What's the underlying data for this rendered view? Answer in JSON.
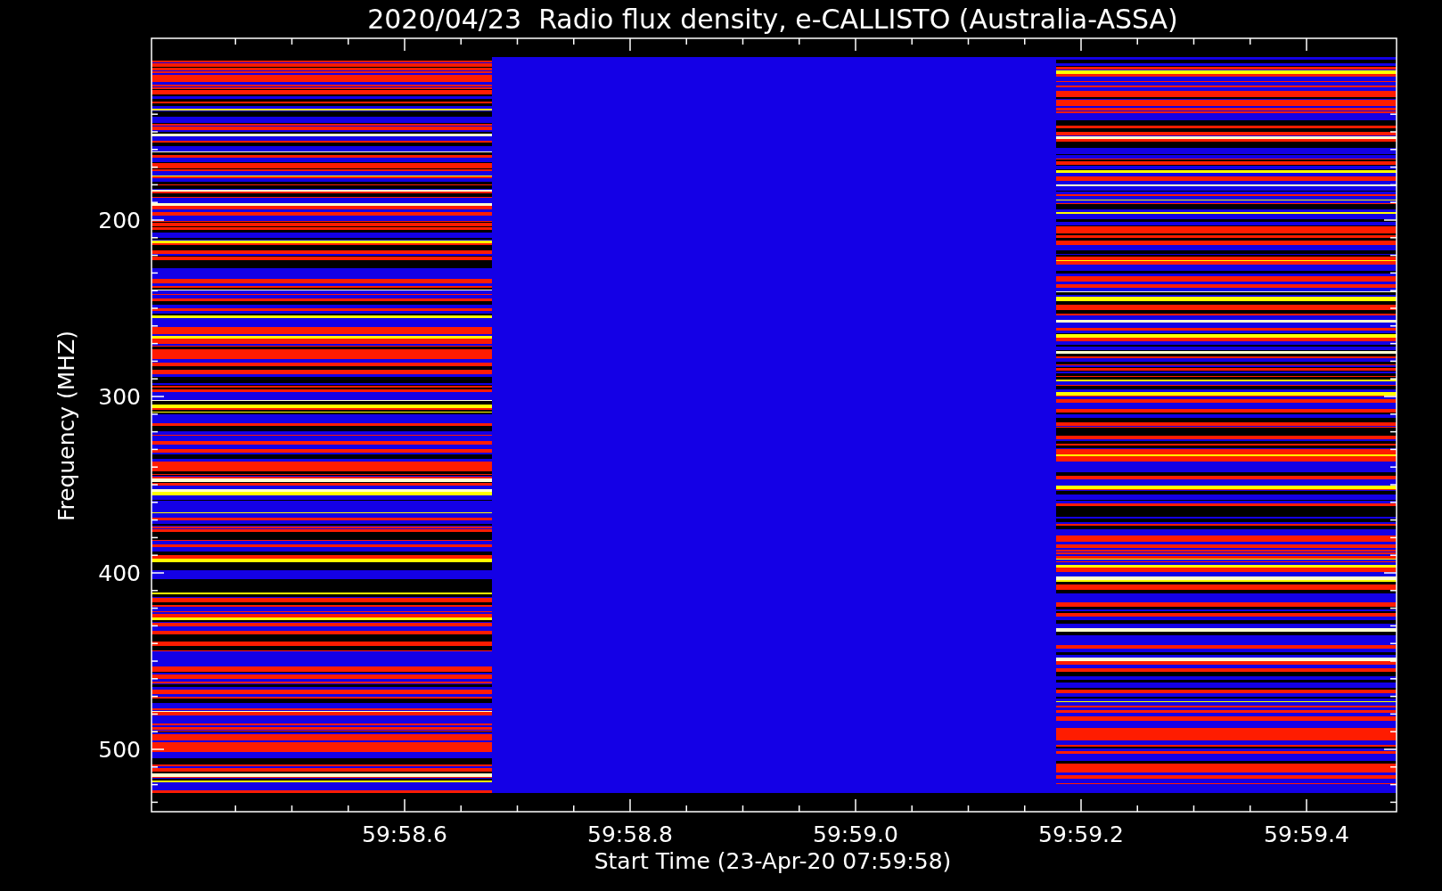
{
  "title": "2020/04/23  Radio flux density, e-CALLISTO (Australia-ASSA)",
  "y_axis": {
    "label": "Frequency (MHZ)",
    "ticks": [
      "200",
      "300",
      "400",
      "500"
    ]
  },
  "x_axis": {
    "label": "Start Time (23-Apr-20 07:59:58)",
    "ticks": [
      "59:58.6",
      "59:58.8",
      "59:59.0",
      "59:59.2",
      "59:59.4"
    ]
  }
}
